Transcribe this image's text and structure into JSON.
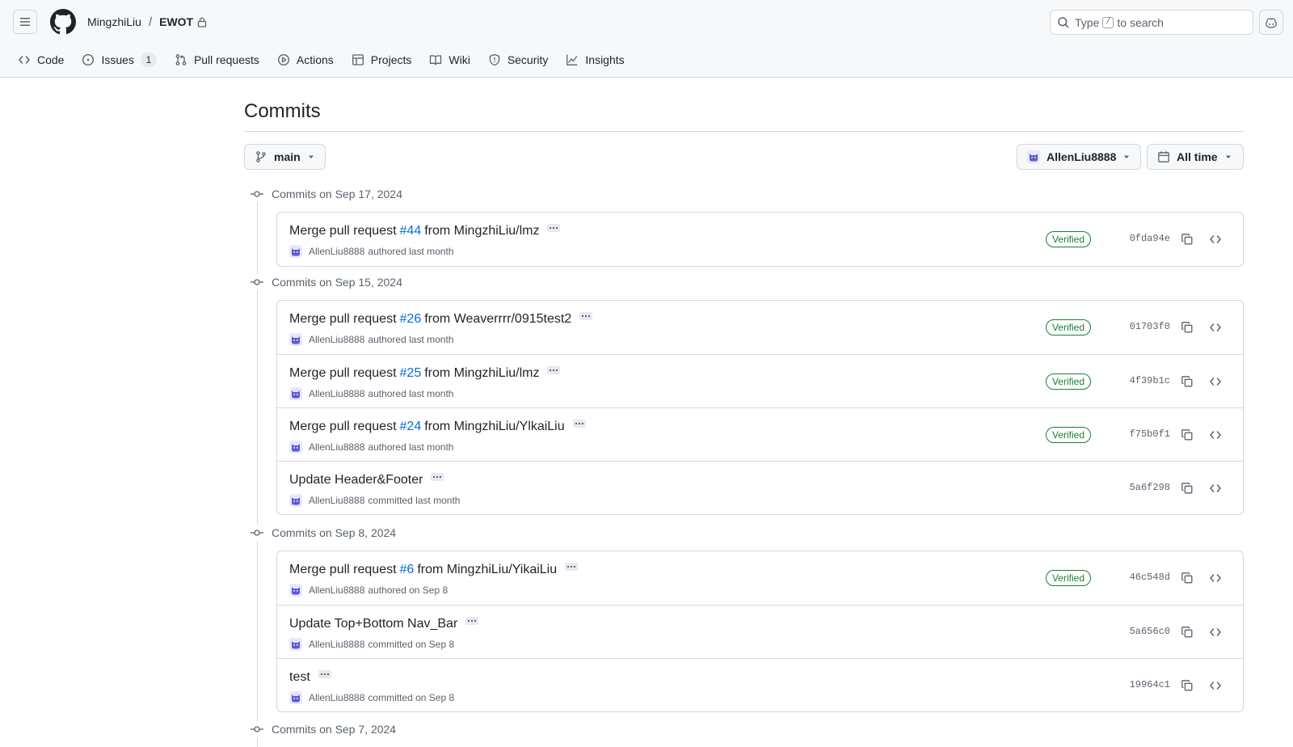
{
  "header": {
    "owner": "MingzhiLiu",
    "separator": "/",
    "repo": "EWOT",
    "search": {
      "pre": "Type",
      "key": "/",
      "post": "to search"
    }
  },
  "nav": {
    "tabs": [
      {
        "label": "Code",
        "icon": "code-icon"
      },
      {
        "label": "Issues",
        "icon": "issue-icon",
        "count": "1"
      },
      {
        "label": "Pull requests",
        "icon": "pull-request-icon"
      },
      {
        "label": "Actions",
        "icon": "play-icon"
      },
      {
        "label": "Projects",
        "icon": "table-icon"
      },
      {
        "label": "Wiki",
        "icon": "book-icon"
      },
      {
        "label": "Security",
        "icon": "shield-icon"
      },
      {
        "label": "Insights",
        "icon": "graph-icon"
      }
    ]
  },
  "page": {
    "title": "Commits",
    "branch": "main",
    "author_filter": "AllenLiu8888",
    "time_filter": "All time"
  },
  "colors": {
    "link": "#0969da",
    "verified": "#1a7f37",
    "muted": "#59636e",
    "avatar": "#5b5bd6"
  },
  "groups": [
    {
      "date_label": "Commits on Sep 17, 2024",
      "commits": [
        {
          "title_pre": "Merge pull request",
          "pr": "#44",
          "title_post": "from MingzhiLiu/lmz",
          "author": "AllenLiu8888",
          "action": "authored last month",
          "verified": "Verified",
          "sha": "0fda94e"
        }
      ]
    },
    {
      "date_label": "Commits on Sep 15, 2024",
      "commits": [
        {
          "title_pre": "Merge pull request",
          "pr": "#26",
          "title_post": "from Weaverrrr/0915test2",
          "author": "AllenLiu8888",
          "action": "authored last month",
          "verified": "Verified",
          "sha": "01703f0"
        },
        {
          "title_pre": "Merge pull request",
          "pr": "#25",
          "title_post": "from MingzhiLiu/lmz",
          "author": "AllenLiu8888",
          "action": "authored last month",
          "verified": "Verified",
          "sha": "4f39b1c"
        },
        {
          "title_pre": "Merge pull request",
          "pr": "#24",
          "title_post": "from MingzhiLiu/YlkaiLiu",
          "author": "AllenLiu8888",
          "action": "authored last month",
          "verified": "Verified",
          "sha": "f75b0f1"
        },
        {
          "title_pre": "Update Header&Footer",
          "pr": "",
          "title_post": "",
          "author": "AllenLiu8888",
          "action": "committed last month",
          "verified": "",
          "sha": "5a6f298"
        }
      ]
    },
    {
      "date_label": "Commits on Sep 8, 2024",
      "commits": [
        {
          "title_pre": "Merge pull request",
          "pr": "#6",
          "title_post": "from MingzhiLiu/YikaiLiu",
          "author": "AllenLiu8888",
          "action": "authored on Sep 8",
          "verified": "Verified",
          "sha": "46c548d"
        },
        {
          "title_pre": "Update Top+Bottom Nav_Bar",
          "pr": "",
          "title_post": "",
          "author": "AllenLiu8888",
          "action": "committed on Sep 8",
          "verified": "",
          "sha": "5a656c0"
        },
        {
          "title_pre": "test",
          "pr": "",
          "title_post": "",
          "author": "AllenLiu8888",
          "action": "committed on Sep 8",
          "verified": "",
          "sha": "19964c1"
        }
      ]
    },
    {
      "date_label": "Commits on Sep 7, 2024",
      "commits": []
    }
  ]
}
